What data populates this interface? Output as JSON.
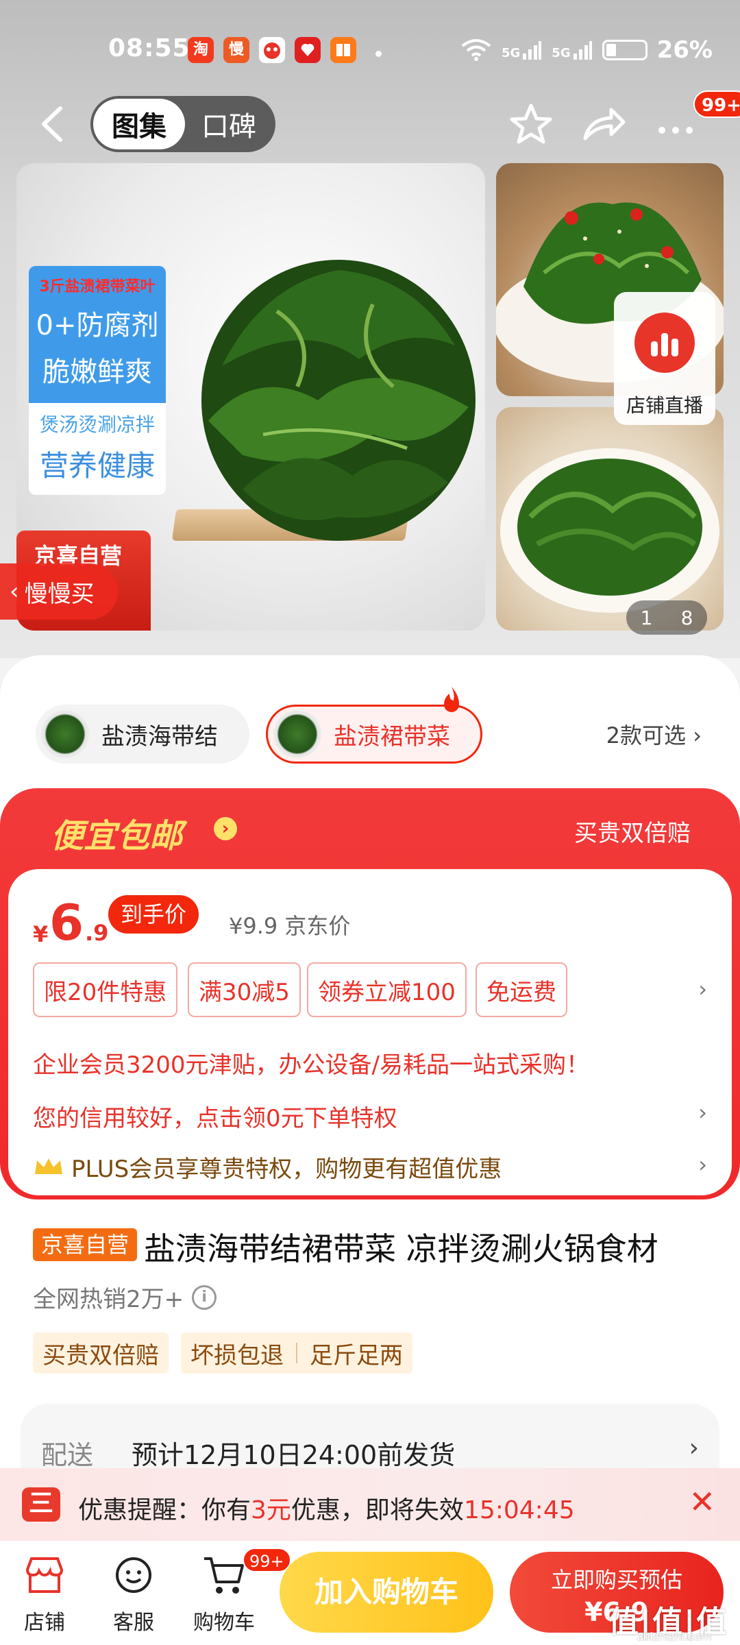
{
  "status_bar": {
    "time": "08:55",
    "app_icons": [
      {
        "name": "taobao-icon",
        "glyph": "淘",
        "color": "#f23a1e"
      },
      {
        "name": "manmanmai-icon",
        "glyph": "慢",
        "color": "#ee5a24"
      },
      {
        "name": "jd-dog-icon",
        "glyph": "",
        "color": "#ffffff"
      },
      {
        "name": "pinduoduo-icon",
        "glyph": "",
        "color": "#e02020"
      },
      {
        "name": "book-icon",
        "glyph": "",
        "color": "#ff7a1a"
      }
    ],
    "signal_1": "5G",
    "signal_2": "5G",
    "battery_percent": "26%"
  },
  "nav": {
    "tab_gallery": "图集",
    "tab_reviews": "口碑",
    "badge": "99+"
  },
  "gallery": {
    "promo_line_0": "3斤盐渍裙带菜叶",
    "promo_line_1": "0+防腐剂",
    "promo_line_2": "脆嫩鲜爽",
    "promo_line_3": "煲汤烫涮凉拌",
    "promo_line_4": "营养健康",
    "brand_tag": "京喜自营",
    "slow_buy": "慢慢买",
    "live_label": "店铺直播",
    "pager_current": "1",
    "pager_total": "8"
  },
  "variants": {
    "items": [
      {
        "label": "盐渍海带结",
        "selected": false
      },
      {
        "label": "盐渍裙带菜",
        "selected": true
      }
    ],
    "more": "2款可选 ›"
  },
  "promo": {
    "cheap_title": "便宜包邮",
    "double_comp": "买贵双倍赔",
    "price_currency": "¥",
    "price_int": "6",
    "price_dec": ".9",
    "price_tag": "到手价",
    "jd_price": "¥9.9 京东价",
    "coupons": [
      "限20件特惠",
      "满30减5",
      "领券立减100",
      "免运费"
    ],
    "enterprise": "企业会员3200元津贴，办公设备/易耗品一站式采购！",
    "credit": "您的信用较好，点击领0元下单特权",
    "plus": "PLUS会员享尊贵特权，购物更有超值优惠",
    "chevron": "›"
  },
  "product": {
    "self_tag": "京喜自营",
    "title": "盐渍海带结裙带菜 凉拌烫涮火锅食材",
    "hot_sales": "全网热销2万+",
    "info_glyph": "i",
    "services": [
      "买贵双倍赔",
      "坏损包退",
      "足斤足两"
    ]
  },
  "delivery": {
    "label": "配送",
    "text": "预计12月10日24:00前发货",
    "chevron": "›"
  },
  "reminder": {
    "icon_glyph": "三",
    "prefix": "优惠提醒：你有",
    "amount": "3元",
    "middle": "优惠，即将失效",
    "countdown": "15:04:45",
    "close": "✕"
  },
  "bottom_bar": {
    "shop": "店铺",
    "service": "客服",
    "cart": "购物车",
    "cart_badge": "99+",
    "add_cart": "加入购物车",
    "buy_now": "立即购买预估",
    "buy_price": "¥6.9"
  },
  "watermark": {
    "main": "值|值|值",
    "sub": "zhizhizhi.com"
  },
  "colors": {
    "jd_red": "#f2270c",
    "coupon_red": "#e8322a",
    "promo_yellow": "#ffe16a",
    "cart_yellow": "#ffc21a"
  }
}
